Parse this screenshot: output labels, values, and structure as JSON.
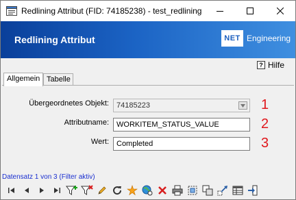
{
  "window": {
    "title": "Redlining Attribut (FID: 74185238) - test_redlining"
  },
  "banner": {
    "title": "Redlining Attribut",
    "logo_mark": "NET",
    "logo_text": "Engineering"
  },
  "help": {
    "label": "Hilfe",
    "icon_glyph": "?"
  },
  "tabs": [
    {
      "label": "Allgemein",
      "active": true
    },
    {
      "label": "Tabelle",
      "active": false
    }
  ],
  "form": {
    "parent_object": {
      "label": "Übergeordnetes Objekt:",
      "value": "74185223"
    },
    "attribute_name": {
      "label": "Attributname:",
      "value": "WORKITEM_STATUS_VALUE"
    },
    "value": {
      "label": "Wert:",
      "value": "Completed"
    }
  },
  "annotations": [
    "1",
    "2",
    "3"
  ],
  "status": {
    "text": "Datensatz 1 von 3 (Filter aktiv)"
  },
  "toolbar": {
    "icons": [
      "first-record-icon",
      "previous-record-icon",
      "next-record-icon",
      "last-record-icon",
      "add-filter-icon",
      "remove-filter-icon",
      "edit-icon",
      "refresh-icon",
      "highlight-icon",
      "zoom-to-icon",
      "delete-icon",
      "print-icon",
      "select-icon",
      "copy-icon",
      "move-icon",
      "table-icon",
      "exit-icon"
    ]
  },
  "colors": {
    "banner_start": "#0a3f9a",
    "banner_end": "#3f8fe0",
    "annotation": "#e0161b",
    "status_text": "#1a2fd0"
  }
}
